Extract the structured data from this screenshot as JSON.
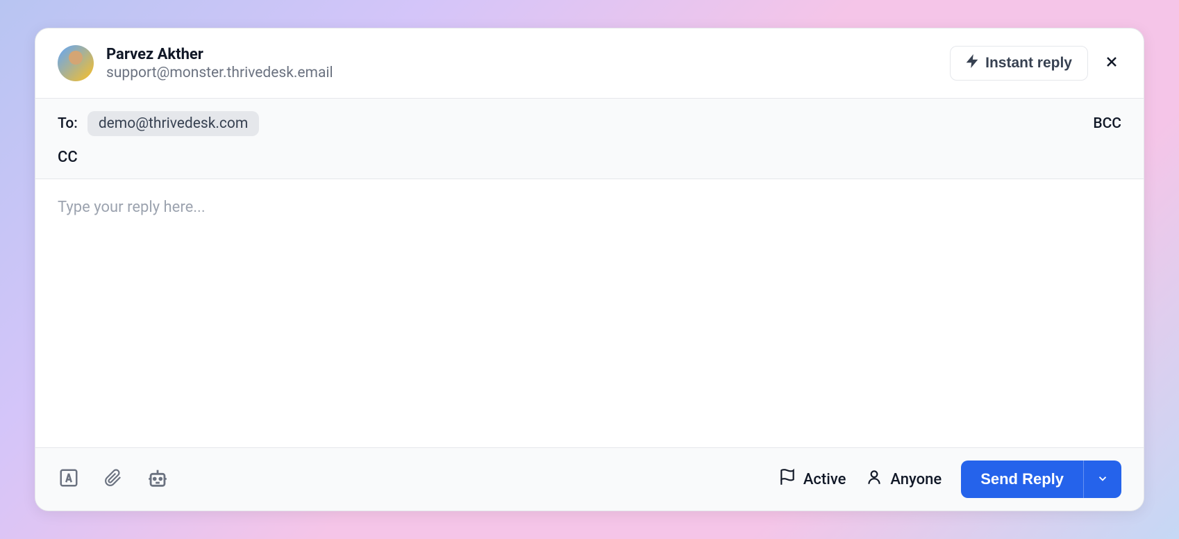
{
  "header": {
    "sender_name": "Parvez Akther",
    "sender_email": "support@monster.thrivedesk.email",
    "instant_reply_label": "Instant reply"
  },
  "recipients": {
    "to_label": "To:",
    "to_email": "demo@thrivedesk.com",
    "cc_label": "CC",
    "bcc_label": "BCC"
  },
  "body": {
    "placeholder": "Type your reply here..."
  },
  "footer": {
    "status_label": "Active",
    "assignee_label": "Anyone",
    "send_label": "Send Reply"
  }
}
